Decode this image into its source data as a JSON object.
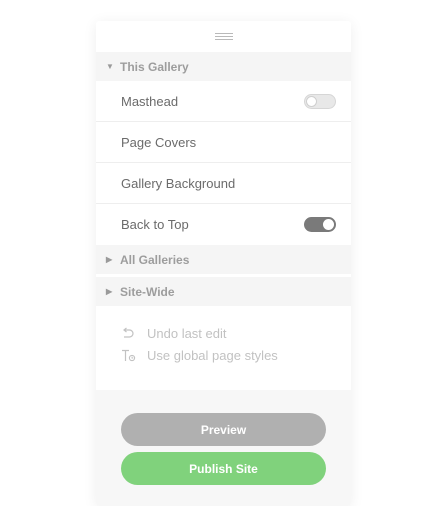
{
  "sections": {
    "this_gallery": {
      "title": "This Gallery",
      "items": [
        {
          "label": "Masthead",
          "toggle": "off"
        },
        {
          "label": "Page Covers"
        },
        {
          "label": "Gallery Background"
        },
        {
          "label": "Back to Top",
          "toggle": "on"
        }
      ]
    },
    "all_galleries": {
      "title": "All Galleries"
    },
    "site_wide": {
      "title": "Site-Wide"
    }
  },
  "actions": {
    "undo": {
      "label": "Undo last edit",
      "icon": "undo-icon"
    },
    "global_styles": {
      "label": "Use global page styles",
      "icon": "text-style-icon"
    }
  },
  "buttons": {
    "preview": "Preview",
    "publish": "Publish Site"
  },
  "colors": {
    "preview_button": "#b0b0b0",
    "publish_button": "#80d27c",
    "toggle_on": "#7a7a7a"
  }
}
